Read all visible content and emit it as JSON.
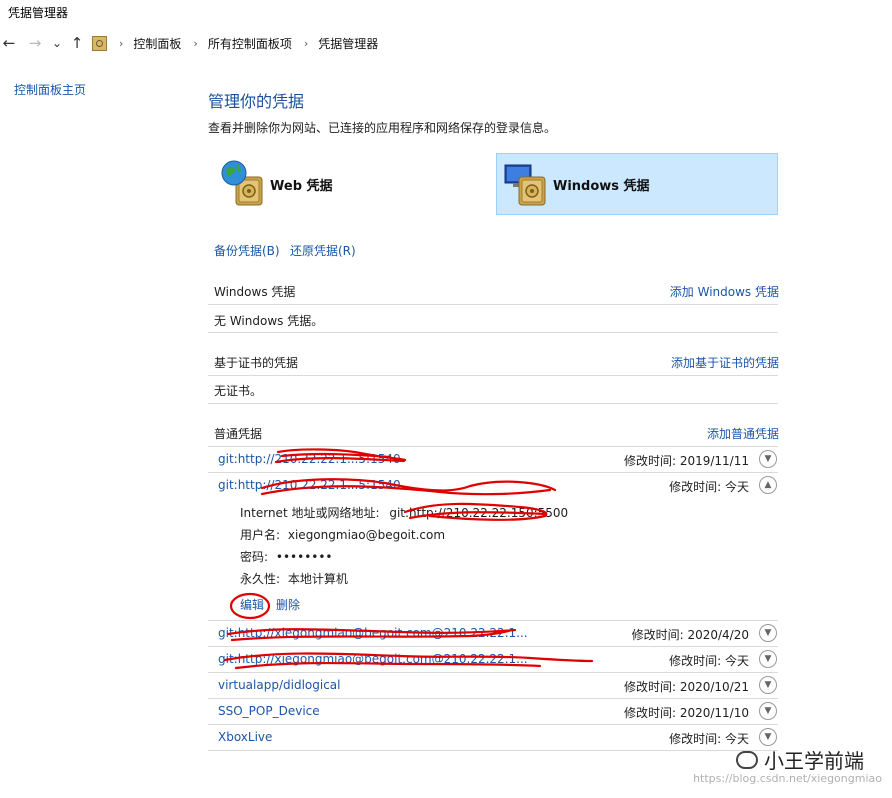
{
  "window": {
    "title": "凭据管理器"
  },
  "nav": {
    "back": "←",
    "forward": "→",
    "recent": "⌄",
    "up": "↑"
  },
  "breadcrumb": {
    "items": [
      "控制面板",
      "所有控制面板项",
      "凭据管理器"
    ],
    "separator": "›"
  },
  "sidebar": {
    "home": "控制面板主页"
  },
  "main": {
    "heading": "管理你的凭据",
    "description": "查看并删除你为网站、已连接的应用程序和网络保存的登录信息。",
    "credential_types": [
      {
        "label": "Web 凭据",
        "icon": "globe-vault-icon"
      },
      {
        "label": "Windows 凭据",
        "icon": "monitor-vault-icon",
        "selected": true
      }
    ],
    "backup": "备份凭据(B)",
    "restore": "还原凭据(R)"
  },
  "sections": {
    "windows": {
      "title": "Windows 凭据",
      "add": "添加 Windows 凭据",
      "empty": "无 Windows 凭据。"
    },
    "certificate": {
      "title": "基于证书的凭据",
      "add": "添加基于证书的凭据",
      "empty": "无证书。"
    },
    "generic": {
      "title": "普通凭据",
      "add": "添加普通凭据",
      "rows": [
        {
          "name": "git:http://210.22.22.1...5:1540",
          "modified": "修改时间:  2019/11/11",
          "expanded": false
        },
        {
          "name": "git:http://210.22.22.1...5:1540",
          "modified": "修改时间:  今天",
          "expanded": true
        },
        {
          "name": "git:http://xiegongmiao@begoit.com@210.22.22.1...",
          "modified": "修改时间:  2020/4/20",
          "expanded": false
        },
        {
          "name": "git:http://xiegongmiao@begoit.com@210.22.22.1...",
          "modified": "修改时间:  今天",
          "expanded": false
        },
        {
          "name": "virtualapp/didlogical",
          "modified": "修改时间:  2020/10/21",
          "expanded": false
        },
        {
          "name": "SSO_POP_Device",
          "modified": "修改时间:  2020/11/10",
          "expanded": false
        },
        {
          "name": "XboxLive",
          "modified": "修改时间:  今天",
          "expanded": false
        }
      ],
      "details": {
        "address_label": "Internet 地址或网络地址:",
        "address_value": "git:http://210.22.22.150:5500",
        "user_label": "用户名:",
        "user_value": "xiegongmiao@begoit.com",
        "password_label": "密码:",
        "password_value": "••••••••",
        "persistence_label": "永久性:",
        "persistence_value": "本地计算机",
        "edit": "编辑",
        "delete": "删除"
      }
    }
  },
  "watermark": {
    "text": "小王学前端",
    "url": "https://blog.csdn.net/xiegongmiao"
  },
  "colors": {
    "link": "#1a56a8",
    "heading": "#1a4f9c",
    "selected_bg": "#cce8ff",
    "selected_border": "#99d1ff",
    "scribble": "#e00000"
  }
}
